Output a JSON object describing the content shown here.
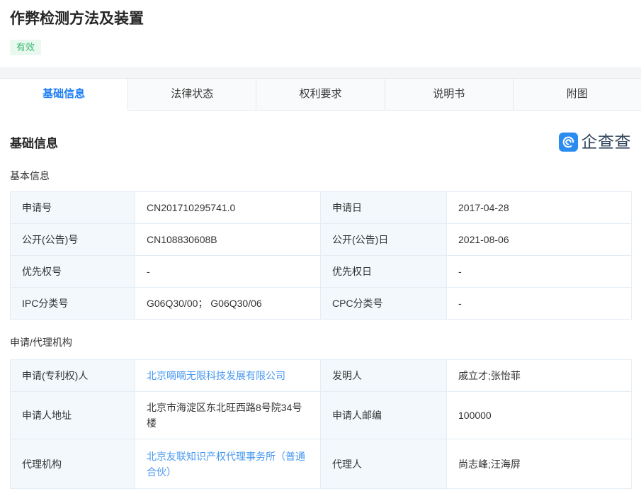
{
  "header": {
    "title": "作弊检测方法及装置",
    "status": "有效"
  },
  "tabs": [
    {
      "label": "基础信息",
      "active": true
    },
    {
      "label": "法律状态",
      "active": false
    },
    {
      "label": "权利要求",
      "active": false
    },
    {
      "label": "说明书",
      "active": false
    },
    {
      "label": "附图",
      "active": false
    }
  ],
  "section": {
    "title": "基础信息",
    "brand_name": "企查查",
    "brand_icon": "qichacha-logo-icon"
  },
  "colors": {
    "accent_blue": "#1e7df4",
    "link_blue": "#4798f0",
    "badge_green": "#3dbb72",
    "badge_bg": "#e9f9f0",
    "label_cell_bg": "#f2f8fc",
    "table_border": "#e4edf4",
    "brand_blue": "#2b8cf0"
  },
  "basic": {
    "heading": "基本信息",
    "rows": [
      {
        "l1": "申请号",
        "v1": "CN201710295741.0",
        "l2": "申请日",
        "v2": "2017-04-28"
      },
      {
        "l1": "公开(公告)号",
        "v1": "CN108830608B",
        "l2": "公开(公告)日",
        "v2": "2021-08-06"
      },
      {
        "l1": "优先权号",
        "v1": "-",
        "l2": "优先权日",
        "v2": "-"
      },
      {
        "l1": "IPC分类号",
        "v1": "G06Q30/00； G06Q30/06",
        "l2": "CPC分类号",
        "v2": "-"
      }
    ]
  },
  "agency": {
    "heading": "申请/代理机构",
    "rows": [
      {
        "l1": "申请(专利权)人",
        "v1": "北京嘀嘀无限科技发展有限公司",
        "l2": "发明人",
        "v2": "戚立才;张怡菲"
      },
      {
        "l1": "申请人地址",
        "v1": "北京市海淀区东北旺西路8号院34号楼",
        "l2": "申请人邮编",
        "v2": "100000"
      },
      {
        "l1": "代理机构",
        "v1": "北京友联知识产权代理事务所（普通合伙）",
        "l2": "代理人",
        "v2": "尚志峰;汪海屏"
      }
    ]
  }
}
